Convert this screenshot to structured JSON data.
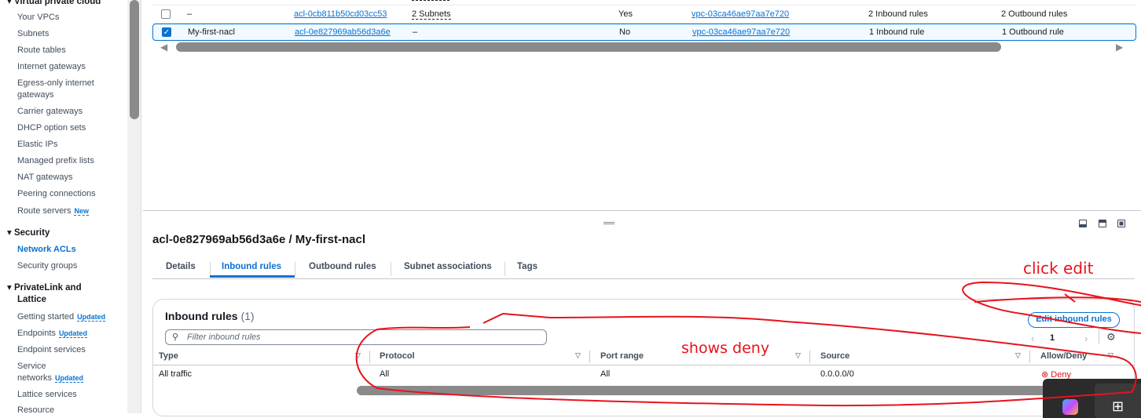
{
  "sidebar": {
    "section_vpc": "Virtual private cloud",
    "vpc_items": [
      "Your VPCs",
      "Subnets",
      "Route tables",
      "Internet gateways",
      "Egress-only internet",
      "gateways",
      "Carrier gateways",
      "DHCP option sets",
      "Elastic IPs",
      "Managed prefix lists",
      "NAT gateways",
      "Peering connections",
      "Route servers"
    ],
    "route_servers_badge": "New",
    "section_security": "Security",
    "security_items": [
      "Network ACLs",
      "Security groups"
    ],
    "section_privatelink": "PrivateLink and",
    "section_privatelink2": "Lattice",
    "pl_items": [
      "Getting started",
      "Endpoints",
      "Endpoint services",
      "Service",
      "networks",
      "Lattice services",
      "Resource"
    ],
    "updated_badge": "Updated"
  },
  "acl_table": {
    "rows": [
      {
        "name": "–",
        "id": "acl-0cb811b50cd03cc53",
        "associated": "2 Subnets",
        "default": "Yes",
        "vpc": "vpc-03ca46ae97aa7e720",
        "inbound": "2 Inbound rules",
        "outbound": "2 Outbound rules",
        "selected": false
      },
      {
        "name": "My-first-nacl",
        "id": "acl-0e827969ab56d3a6e",
        "associated": "–",
        "default": "No",
        "vpc": "vpc-03ca46ae97aa7e720",
        "inbound": "1 Inbound rule",
        "outbound": "1 Outbound rule",
        "selected": true
      }
    ]
  },
  "detail": {
    "title": "acl-0e827969ab56d3a6e / My-first-nacl",
    "tabs": [
      "Details",
      "Inbound rules",
      "Outbound rules",
      "Subnet associations",
      "Tags"
    ],
    "active_tab": "Inbound rules",
    "panel_title": "Inbound rules",
    "panel_count": "(1)",
    "edit_button": "Edit inbound rules",
    "filter_placeholder": "Filter inbound rules",
    "page": "1",
    "columns": [
      "Type",
      "Protocol",
      "Port range",
      "Source",
      "Allow/Deny"
    ],
    "rows": [
      {
        "type": "All traffic",
        "protocol": "All",
        "port": "All",
        "source": "0.0.0.0/0",
        "action": "Deny"
      }
    ]
  },
  "annotations": {
    "click_edit": "click edit",
    "shows_deny": "shows deny"
  },
  "colors": {
    "accent": "#0972d3",
    "deny": "#d91515",
    "annotation": "#e8121b"
  }
}
